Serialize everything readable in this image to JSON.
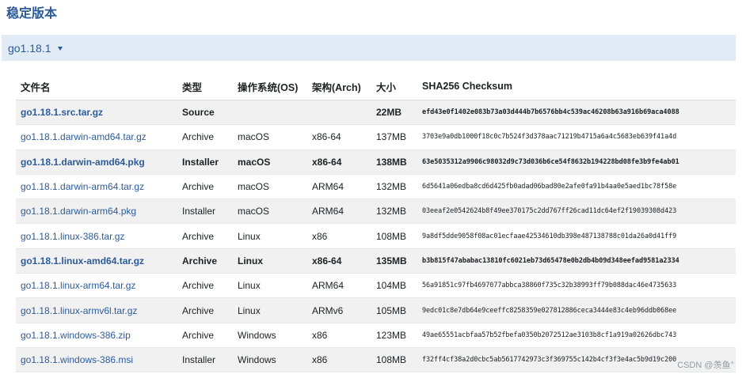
{
  "section": {
    "title": "稳定版本"
  },
  "version_selector": {
    "value": "go1.18.1"
  },
  "table": {
    "headers": {
      "file": "文件名",
      "type": "类型",
      "os": "操作系统(OS)",
      "arch": "架构(Arch)",
      "size": "大小",
      "sha": "SHA256 Checksum"
    },
    "rows": [
      {
        "file": "go1.18.1.src.tar.gz",
        "type": "Source",
        "os": "",
        "arch": "",
        "size": "22MB",
        "sha": "efd43e0f1402e083b73a03d444b7b6576bb4c539ac46208b63a916b69aca4088"
      },
      {
        "file": "go1.18.1.darwin-amd64.tar.gz",
        "type": "Archive",
        "os": "macOS",
        "arch": "x86-64",
        "size": "137MB",
        "sha": "3703e9a0db1000f18c0c7b524f3d378aac71219b4715a6a4c5683eb639f41a4d"
      },
      {
        "file": "go1.18.1.darwin-amd64.pkg",
        "type": "Installer",
        "os": "macOS",
        "arch": "x86-64",
        "size": "138MB",
        "sha": "63e5035312a9906c98032d9c73d036b6ce54f8632b194228bd08fe3b9fe4ab01"
      },
      {
        "file": "go1.18.1.darwin-arm64.tar.gz",
        "type": "Archive",
        "os": "macOS",
        "arch": "ARM64",
        "size": "132MB",
        "sha": "6d5641a06edba8cd6d425fb0adad06bad80e2afe0fa91b4aa0e5aed1bc78f58e"
      },
      {
        "file": "go1.18.1.darwin-arm64.pkg",
        "type": "Installer",
        "os": "macOS",
        "arch": "ARM64",
        "size": "132MB",
        "sha": "03eeaf2e0542624b8f49ee370175c2dd767ff26cad11dc64ef2f19039308d423"
      },
      {
        "file": "go1.18.1.linux-386.tar.gz",
        "type": "Archive",
        "os": "Linux",
        "arch": "x86",
        "size": "108MB",
        "sha": "9a8df5dde9058f08ac01ecfaae42534610db398e487138788c01da26a0d41ff9"
      },
      {
        "file": "go1.18.1.linux-amd64.tar.gz",
        "type": "Archive",
        "os": "Linux",
        "arch": "x86-64",
        "size": "135MB",
        "sha": "b3b815f47ababac13810fc6021eb73d65478e0b2db4b09d348eefad9581a2334"
      },
      {
        "file": "go1.18.1.linux-arm64.tar.gz",
        "type": "Archive",
        "os": "Linux",
        "arch": "ARM64",
        "size": "104MB",
        "sha": "56a91851c97fb4697077abbca38860f735c32b38993ff79b088dac46e4735633"
      },
      {
        "file": "go1.18.1.linux-armv6l.tar.gz",
        "type": "Archive",
        "os": "Linux",
        "arch": "ARMv6",
        "size": "105MB",
        "sha": "9edc01c8e7db64e9ceeffc8258359e027812886ceca3444e83c4eb96ddb068ee"
      },
      {
        "file": "go1.18.1.windows-386.zip",
        "type": "Archive",
        "os": "Windows",
        "arch": "x86",
        "size": "123MB",
        "sha": "49ae65551acbfaa57b52fbefa0350b2072512ae3103b8cf1a919a02626dbc743"
      },
      {
        "file": "go1.18.1.windows-386.msi",
        "type": "Installer",
        "os": "Windows",
        "arch": "x86",
        "size": "108MB",
        "sha": "f32ff4cf38a2d0cbc5ab5617742973c3f369755c142b4cf3f3e4ac5b9d19c200"
      }
    ]
  },
  "watermark": "CSDN @羡鱼°",
  "colors": {
    "accent_blue": "#2c5b9a",
    "selector_bg": "#e0ebf5",
    "stripe_bg": "#f1f1f1"
  }
}
